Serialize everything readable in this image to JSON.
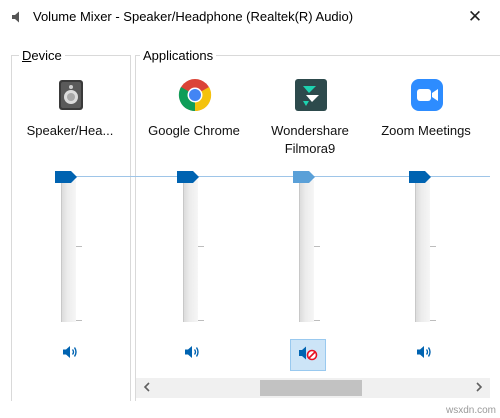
{
  "window": {
    "title": "Volume Mixer - Speaker/Headphone (Realtek(R) Audio)",
    "close_glyph": "✕"
  },
  "groups": {
    "device_label_accel": "D",
    "device_label_rest": "evice",
    "applications_label": "Applications"
  },
  "device": {
    "name": "Speaker/Hea...",
    "icon": "speaker-device-icon"
  },
  "apps": [
    {
      "name_line1": "Google Chrome",
      "name_line2": "",
      "icon": "chrome-icon",
      "muted": false
    },
    {
      "name_line1": "Wondershare",
      "name_line2": "Filmora9",
      "icon": "filmora-icon",
      "muted": true
    },
    {
      "name_line1": "Zoom Meetings",
      "name_line2": "",
      "icon": "zoom-icon",
      "muted": false
    }
  ],
  "volume_levels": {
    "device": 1.0,
    "chrome": 1.0,
    "filmora": 1.0,
    "zoom": 1.0
  },
  "colors": {
    "accent": "#0063b1",
    "chrome_red": "#db4437",
    "chrome_yellow": "#f4c20d",
    "chrome_green": "#0f9d58",
    "chrome_blue": "#4285f4",
    "filmora_bg": "#2d4a4c",
    "filmora_accent": "#1dd3b0",
    "zoom_blue": "#2d8cff",
    "mute_red": "#e81123"
  },
  "footer": {
    "watermark": "wsxdn.com"
  }
}
